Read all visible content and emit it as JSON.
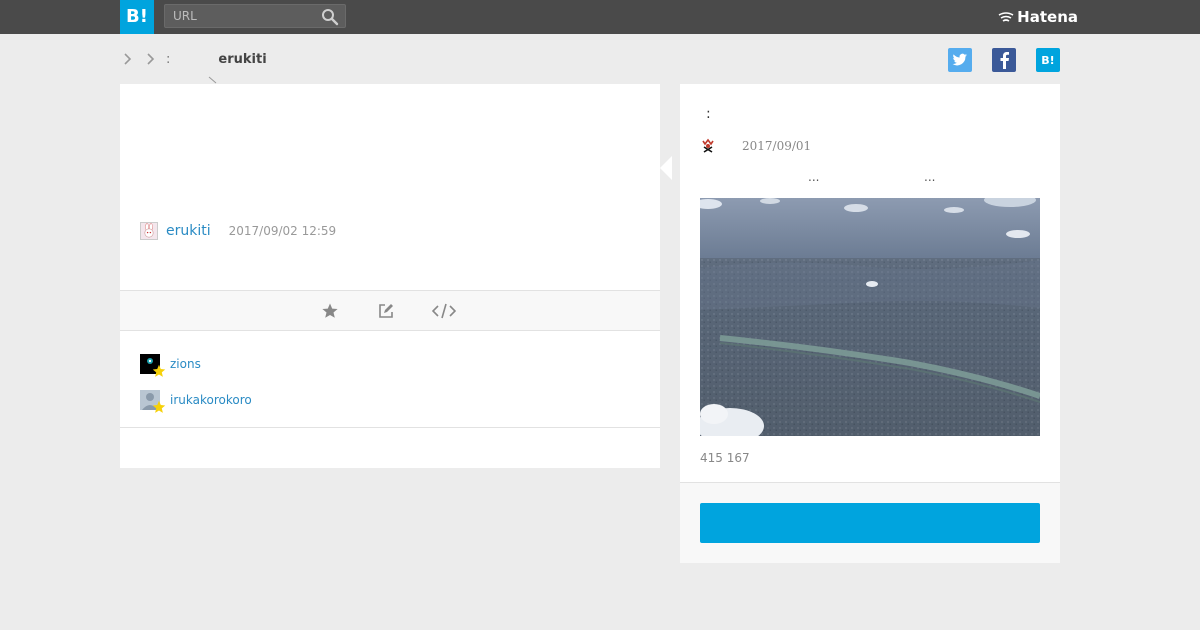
{
  "header": {
    "logo_text": "B!",
    "search_placeholder": "URL",
    "brand": "Hatena",
    "bg_color": "#4a4a4a",
    "accent": "#00a4de"
  },
  "breadcrumb": {
    "colon": ":",
    "user": "erukiti"
  },
  "share": {
    "twitter_icon": "twitter-icon",
    "facebook_icon": "facebook-icon",
    "hatena_label": "B!"
  },
  "comment": {
    "user": "erukiti",
    "date": "2017/09/02 12:59"
  },
  "stars": [
    {
      "user": "zions"
    },
    {
      "user": "irukakorokoro"
    }
  ],
  "entry": {
    "title": ":",
    "date": "2017/09/01",
    "desc_part1": "...",
    "desc_part2": "...",
    "counts": "415 167"
  }
}
